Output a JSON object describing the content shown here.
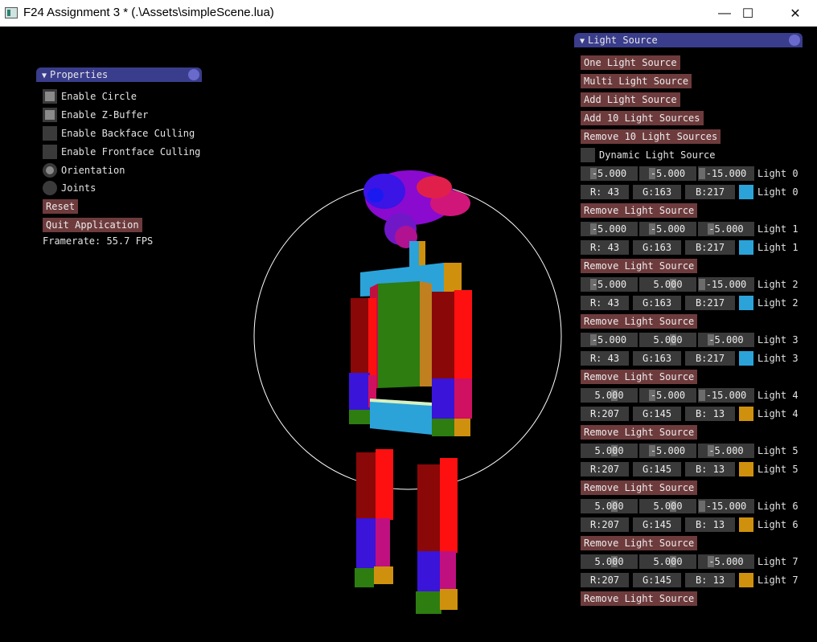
{
  "window": {
    "title": "F24 Assignment 3 * (.\\Assets\\simpleScene.lua)",
    "minimize_glyph": "—",
    "maximize_glyph": "☐",
    "close_glyph": "✕"
  },
  "properties": {
    "title": "Properties",
    "options": [
      {
        "label": "Enable Circle",
        "checked": true
      },
      {
        "label": "Enable Z-Buffer",
        "checked": true
      },
      {
        "label": "Enable Backface Culling",
        "checked": false
      },
      {
        "label": "Enable Frontface Culling",
        "checked": false
      }
    ],
    "modes": [
      {
        "label": "Orientation",
        "selected": true
      },
      {
        "label": "Joints",
        "selected": false
      }
    ],
    "reset_label": "Reset",
    "quit_label": "Quit Application",
    "framerate": "Framerate: 55.7 FPS"
  },
  "light_panel": {
    "title": "Light Source",
    "buttons": [
      "One Light Source",
      "Multi Light Source",
      "Add Light Source",
      "Add 10 Light Sources",
      "Remove 10 Light Sources"
    ],
    "dynamic_label": "Dynamic Light Source",
    "remove_label": "Remove Light Source",
    "lights": [
      {
        "name": "Light 0",
        "pos": [
          "-5.000",
          "-5.000",
          "-15.000"
        ],
        "rgb": [
          "R: 43",
          "G:163",
          "B:217"
        ],
        "color": "#2ba3d9"
      },
      {
        "name": "Light 1",
        "pos": [
          "-5.000",
          "-5.000",
          "-5.000"
        ],
        "rgb": [
          "R: 43",
          "G:163",
          "B:217"
        ],
        "color": "#2ba3d9"
      },
      {
        "name": "Light 2",
        "pos": [
          "-5.000",
          "5.000",
          "-15.000"
        ],
        "rgb": [
          "R: 43",
          "G:163",
          "B:217"
        ],
        "color": "#2ba3d9"
      },
      {
        "name": "Light 3",
        "pos": [
          "-5.000",
          "5.000",
          "-5.000"
        ],
        "rgb": [
          "R: 43",
          "G:163",
          "B:217"
        ],
        "color": "#2ba3d9"
      },
      {
        "name": "Light 4",
        "pos": [
          "5.000",
          "-5.000",
          "-15.000"
        ],
        "rgb": [
          "R:207",
          "G:145",
          "B: 13"
        ],
        "color": "#cf910d"
      },
      {
        "name": "Light 5",
        "pos": [
          "5.000",
          "-5.000",
          "-5.000"
        ],
        "rgb": [
          "R:207",
          "G:145",
          "B: 13"
        ],
        "color": "#cf910d"
      },
      {
        "name": "Light 6",
        "pos": [
          "5.000",
          "5.000",
          "-15.000"
        ],
        "rgb": [
          "R:207",
          "G:145",
          "B: 13"
        ],
        "color": "#cf910d"
      },
      {
        "name": "Light 7",
        "pos": [
          "5.000",
          "5.000",
          "-5.000"
        ],
        "rgb": [
          "R:207",
          "G:145",
          "B: 13"
        ],
        "color": "#cf910d"
      }
    ]
  }
}
